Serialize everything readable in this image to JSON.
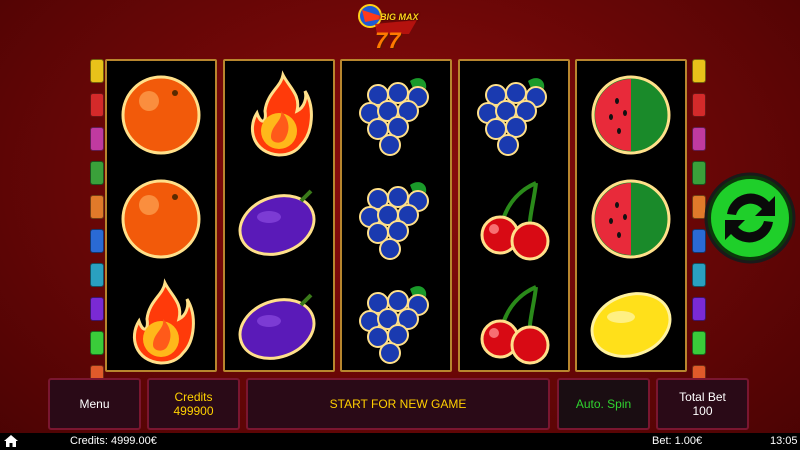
{
  "logo": {
    "title": "BIG MAX",
    "number": "77"
  },
  "reels": [
    [
      "orange",
      "orange",
      "fire"
    ],
    [
      "fire",
      "plum",
      "plum"
    ],
    [
      "grapes",
      "grapes",
      "grapes"
    ],
    [
      "grapes",
      "cherry",
      "cherry"
    ],
    [
      "watermelon",
      "watermelon",
      "lemon"
    ]
  ],
  "payline_colors_left": [
    "#e8c21a",
    "#d42a2a",
    "#c03aa0",
    "#3aa03a",
    "#e07a2a",
    "#2a6ad4",
    "#2aa0c0",
    "#7a2ad4",
    "#3acc3a",
    "#e05a2a"
  ],
  "payline_colors_right": [
    "#e8c21a",
    "#d42a2a",
    "#c03aa0",
    "#3aa03a",
    "#e07a2a",
    "#2a6ad4",
    "#2aa0c0",
    "#7a2ad4",
    "#3acc3a",
    "#e05a2a"
  ],
  "buttons": {
    "menu": "Menu",
    "credits_label": "Credits",
    "credits_value": "499900",
    "start": "START FOR NEW GAME",
    "auto_spin": "Auto. Spin",
    "total_bet_label": "Total Bet",
    "total_bet_value": "100"
  },
  "statusbar": {
    "credits": "Credits: 4999.00€",
    "bet": "Bet: 1.00€",
    "time": "13:05"
  },
  "spin_icon": "refresh-arrows-icon"
}
